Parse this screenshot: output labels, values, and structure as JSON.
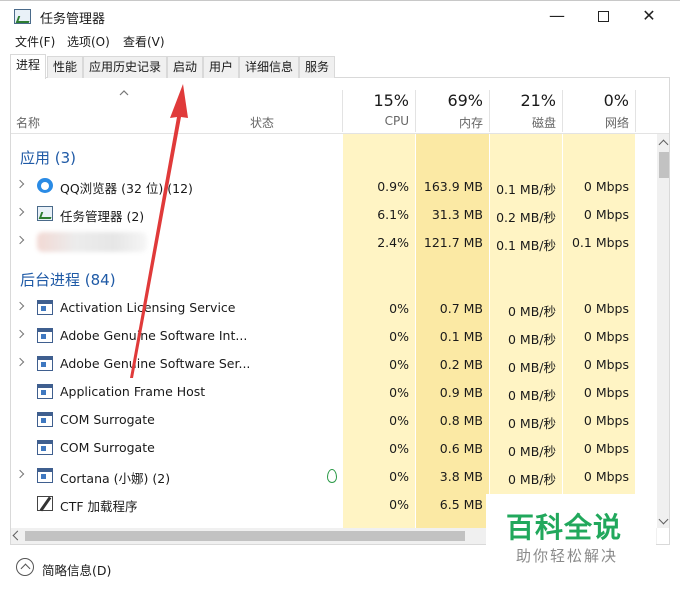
{
  "window": {
    "title": "任务管理器",
    "min_glyph": "—",
    "close_glyph": "✕"
  },
  "menu": [
    "文件(F)",
    "选项(O)",
    "查看(V)"
  ],
  "tabs": [
    "进程",
    "性能",
    "应用历史记录",
    "启动",
    "用户",
    "详细信息",
    "服务"
  ],
  "header": {
    "name": "名称",
    "status": "状态",
    "cpu_pct": "15%",
    "cpu": "CPU",
    "mem_pct": "69%",
    "mem": "内存",
    "disk_pct": "21%",
    "disk": "磁盘",
    "net_pct": "0%",
    "net": "网络"
  },
  "groups": {
    "apps": "应用 (3)",
    "background": "后台进程 (84)"
  },
  "apps": [
    {
      "name": "QQ浏览器 (32 位) (12)",
      "icon": "qq-browser-icon",
      "cpu": "0.9%",
      "mem": "163.9 MB",
      "disk": "0.1 MB/秒",
      "net": "0 Mbps"
    },
    {
      "name": "任务管理器 (2)",
      "icon": "task-manager-icon",
      "cpu": "6.1%",
      "mem": "31.3 MB",
      "disk": "0.2 MB/秒",
      "net": "0 Mbps"
    },
    {
      "name": "",
      "icon": "blurred",
      "cpu": "2.4%",
      "mem": "121.7 MB",
      "disk": "0.1 MB/秒",
      "net": "0.1 Mbps"
    }
  ],
  "background": [
    {
      "name": "Activation Licensing Service",
      "icon": "window-icon",
      "cpu": "0%",
      "mem": "0.7 MB",
      "disk": "0 MB/秒",
      "net": "0 Mbps"
    },
    {
      "name": "Adobe Genuine Software Int...",
      "icon": "window-icon",
      "cpu": "0%",
      "mem": "0.1 MB",
      "disk": "0 MB/秒",
      "net": "0 Mbps"
    },
    {
      "name": "Adobe Genuine Software Ser...",
      "icon": "window-icon",
      "cpu": "0%",
      "mem": "0.2 MB",
      "disk": "0 MB/秒",
      "net": "0 Mbps"
    },
    {
      "name": "Application Frame Host",
      "icon": "window-icon",
      "cpu": "0%",
      "mem": "0.9 MB",
      "disk": "0 MB/秒",
      "net": "0 Mbps"
    },
    {
      "name": "COM Surrogate",
      "icon": "window-icon",
      "cpu": "0%",
      "mem": "0.8 MB",
      "disk": "0 MB/秒",
      "net": "0 Mbps"
    },
    {
      "name": "COM Surrogate",
      "icon": "window-icon",
      "cpu": "0%",
      "mem": "0.6 MB",
      "disk": "0 MB/秒",
      "net": "0 Mbps"
    },
    {
      "name": "Cortana (小娜) (2)",
      "icon": "window-icon",
      "cpu": "0%",
      "mem": "3.8 MB",
      "disk": "0 MB/秒",
      "net": "0 Mbps"
    },
    {
      "name": "CTF 加载程序",
      "icon": "ctf-loader-icon",
      "cpu": "0%",
      "mem": "6.5 MB",
      "disk": "",
      "net": ""
    }
  ],
  "footer": {
    "fewer_details": "简略信息(D)"
  },
  "watermark": {
    "main": "百科全说",
    "sub": "助你轻松解决"
  },
  "colors": {
    "group_text": "#1f5aa6",
    "heat_light": "#fff4c4",
    "heat_strong": "#fbe9a4",
    "arrow": "#e03a3a",
    "watermark_green": "#21a85c"
  }
}
